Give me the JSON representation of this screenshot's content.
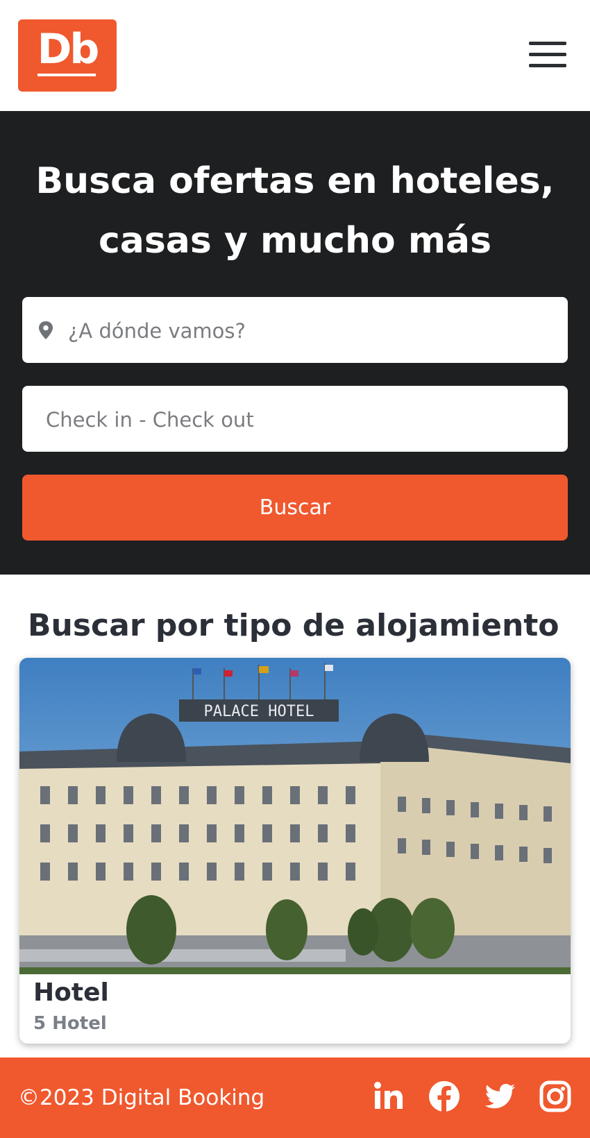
{
  "header": {
    "logo_text": "Db",
    "menu_icon": "hamburger-menu-icon"
  },
  "hero": {
    "title_line1": "Busca ofertas en hoteles,",
    "title_line2": "casas y mucho más",
    "destination_placeholder": "¿A dónde vamos?",
    "destination_icon": "location-pin-icon",
    "dates_placeholder": "Check in - Check out",
    "search_label": "Buscar"
  },
  "categories": {
    "title": "Buscar por tipo de alojamiento",
    "items": [
      {
        "title": "Hotel",
        "subtitle": "5 Hotel",
        "image_sign_text": "PALACE HOTEL"
      }
    ]
  },
  "footer": {
    "copyright": "©2023 Digital Booking",
    "social_icons": [
      "linkedin-icon",
      "facebook-icon",
      "twitter-icon",
      "instagram-icon"
    ]
  },
  "colors": {
    "brand": "#f0582e",
    "hero_bg": "#1d1f21",
    "text_dark": "#2b2f38",
    "text_muted": "#7a7f88"
  }
}
